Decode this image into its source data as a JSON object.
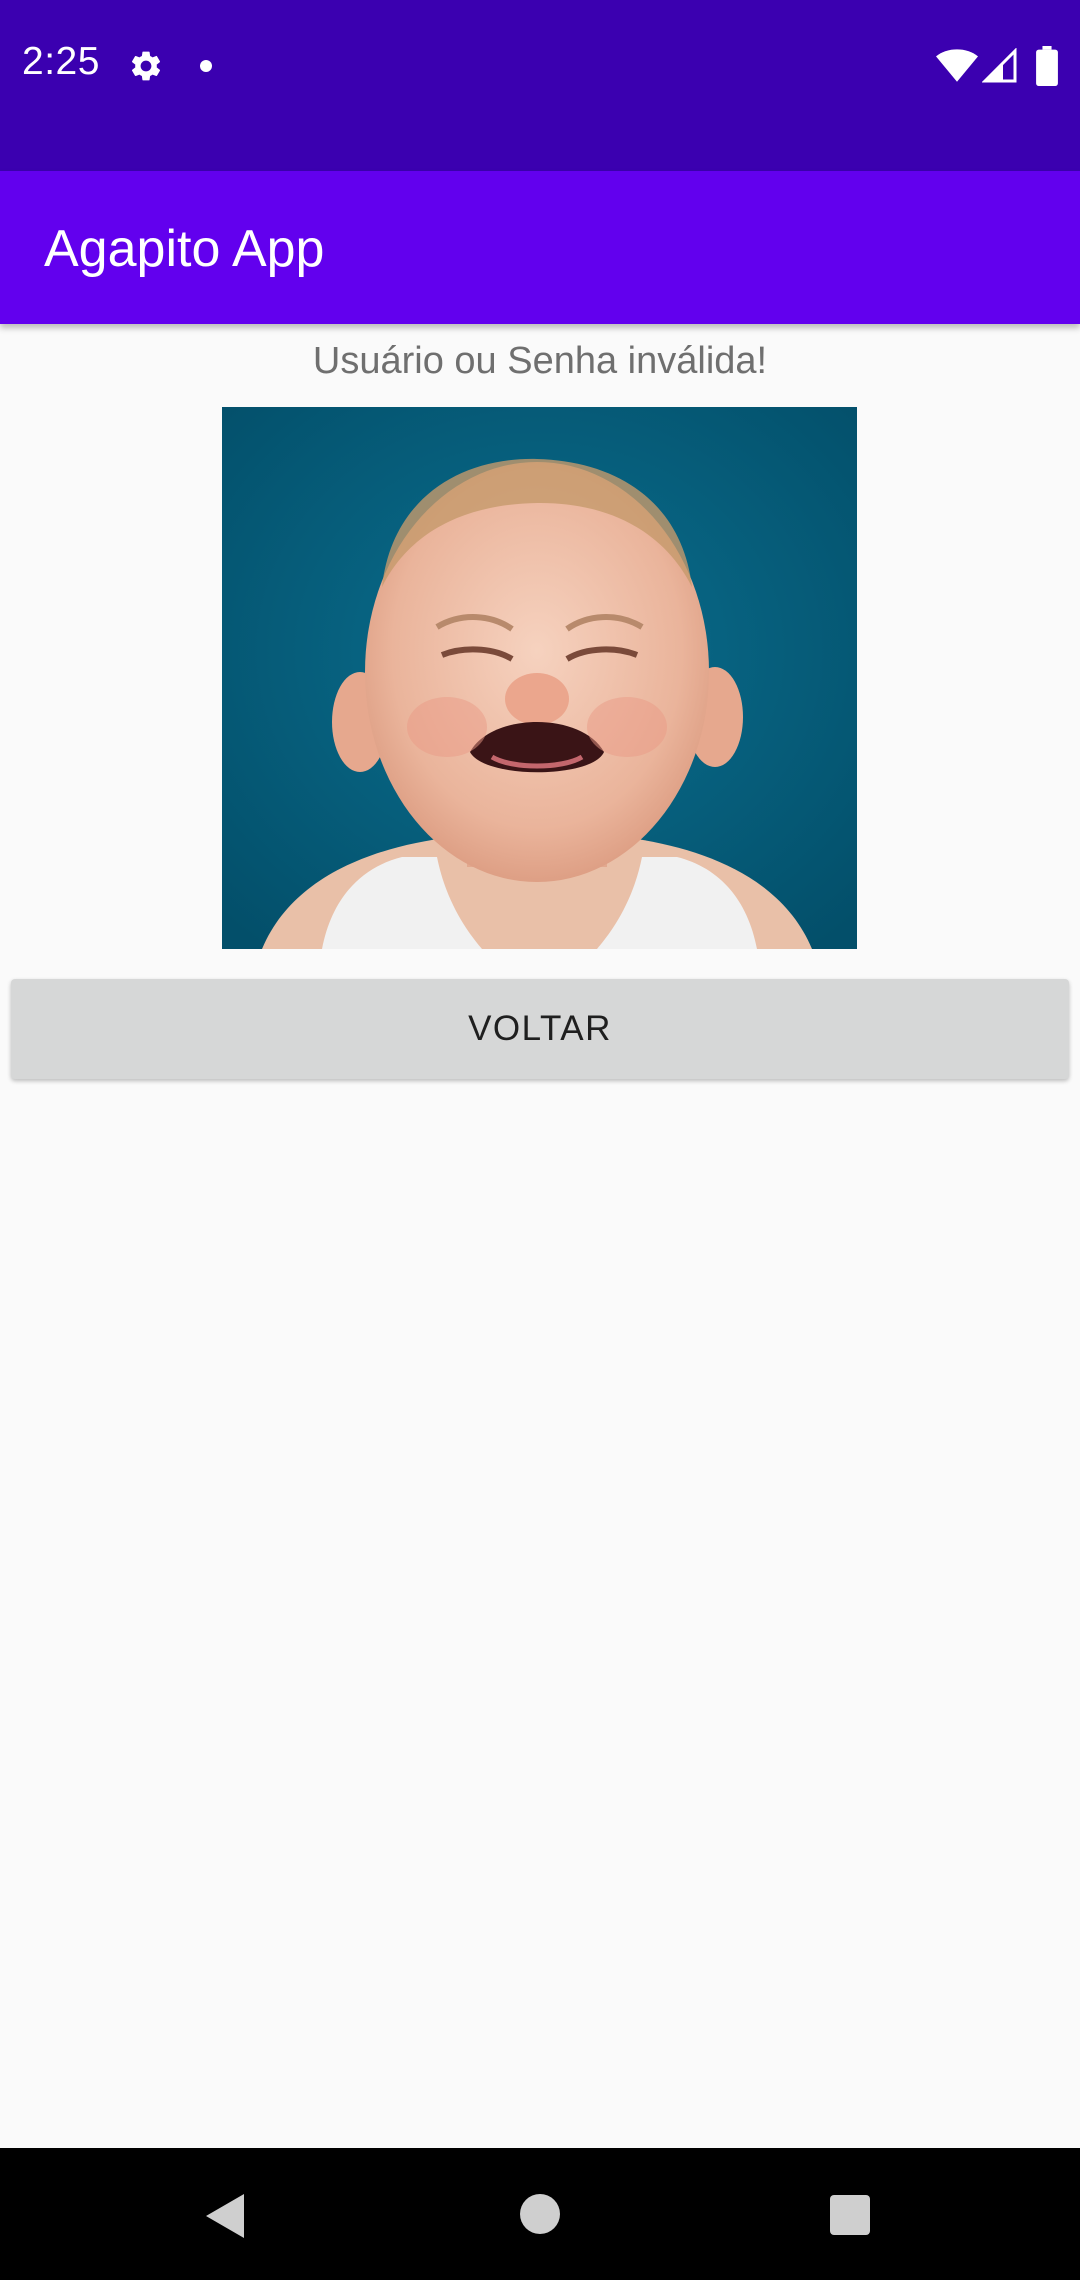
{
  "status_bar": {
    "time": "2:25",
    "icons": [
      "settings-gear-icon",
      "notification-dot-icon",
      "wifi-icon",
      "cell-signal-icon",
      "battery-icon"
    ],
    "background_color": "#3b00b0"
  },
  "app_bar": {
    "title": "Agapito App",
    "background_color": "#6200ee"
  },
  "content": {
    "message": "Usuário ou Senha inválida!",
    "image": {
      "subject": "crying-baby-photo"
    },
    "button": {
      "label": "VOLTAR"
    }
  },
  "nav_bar": {
    "icons": [
      "back-icon",
      "home-icon",
      "recents-icon"
    ]
  }
}
